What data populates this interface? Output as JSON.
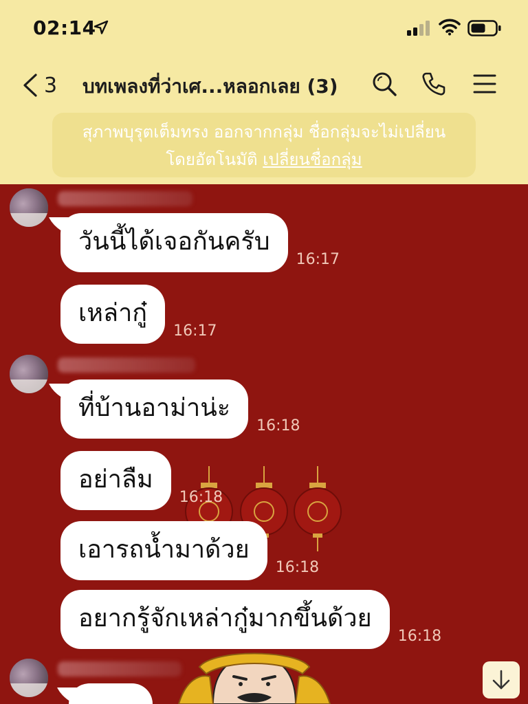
{
  "status_bar": {
    "time": "02:14",
    "icons": [
      "location-arrow-icon",
      "cellular-signal-icon",
      "wifi-icon",
      "battery-icon"
    ]
  },
  "header": {
    "back_count": "3",
    "title": "บทเพลงที่ว่าเศ...หลอกเลย (3)",
    "actions": [
      "search-icon",
      "phone-icon",
      "menu-icon"
    ]
  },
  "notice": {
    "text_line1": "สุภาพบุรุตเต็มทรง ออกจากกลุ่ม ชื่อกลุ่มจะไม่เปลี่ยน",
    "text_line2": "โดยอัตโนมัติ",
    "link": "เปลี่ยนชื่อกลุ่ม"
  },
  "messages": [
    {
      "text": "วันนี้ได้เจอกันครับ",
      "time": "16:17"
    },
    {
      "text": "เหล่ากู๋",
      "time": "16:17"
    },
    {
      "text": "ที่บ้านอาม่าน่ะ",
      "time": "16:18"
    },
    {
      "text": "อย่าลืม",
      "time": "16:18"
    },
    {
      "text": "เอารถน้ำมาด้วย",
      "time": "16:18"
    },
    {
      "text": "อยากรู้จักเหล่ากู๋มากขึ้นด้วย",
      "time": "16:18"
    }
  ],
  "colors": {
    "header_bg": "#f6e9a3",
    "notice_bg": "#efe08f",
    "chat_bg": "#8f1510",
    "bubble_bg": "#ffffff",
    "timestamp": "#f0c8b8"
  }
}
